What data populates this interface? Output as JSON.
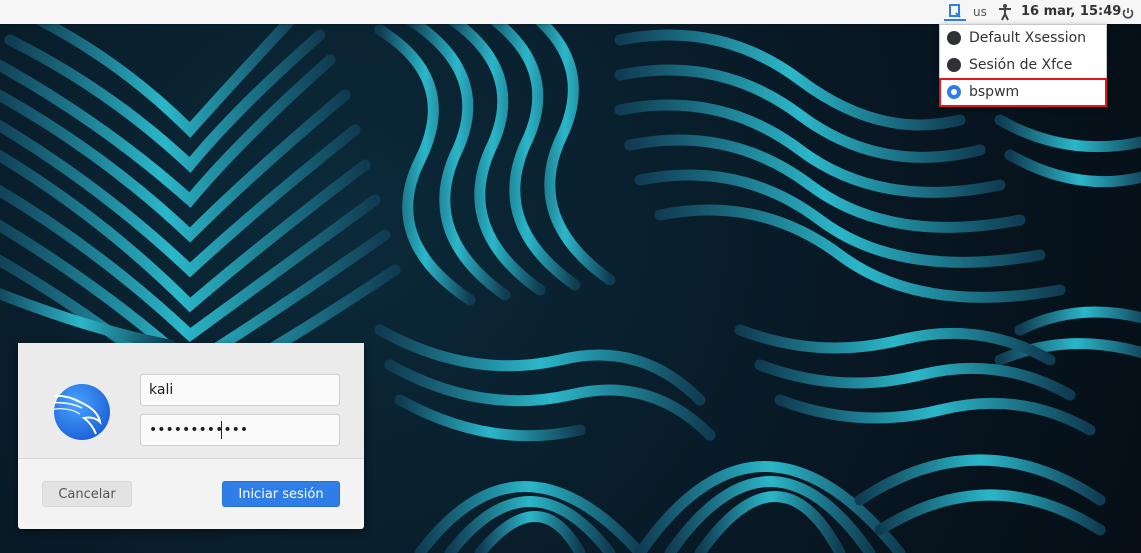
{
  "top_panel": {
    "keyboard_layout": "us",
    "datetime": "16 mar, 15:49",
    "session_icon": "session-chooser-icon",
    "accessibility_icon": "accessibility-icon",
    "power_icon": "power-icon"
  },
  "session_menu": {
    "items": [
      {
        "label": "Default Xsession",
        "selected": false
      },
      {
        "label": "Sesión de Xfce",
        "selected": false
      },
      {
        "label": "bspwm",
        "selected": true
      }
    ]
  },
  "login": {
    "username": "kali",
    "password_masked": "••••••••••••",
    "cancel_label": "Cancelar",
    "login_label": "Iniciar sesión",
    "avatar_icon": "kali-dragon-icon"
  },
  "colors": {
    "accent": "#2f7ee8",
    "highlight_box": "#e4161b",
    "wallpaper_stripe": "#2bb7c9"
  }
}
